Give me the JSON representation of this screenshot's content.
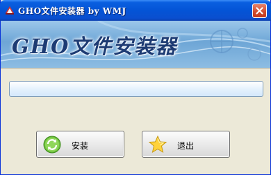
{
  "window": {
    "title": "GHO文件安装器  by WMJ"
  },
  "banner": {
    "title": "GHO文件安装器"
  },
  "progress": {
    "value_percent": 0
  },
  "buttons": {
    "install_label": "安装",
    "exit_label": "退出"
  },
  "icons": {
    "app": "app-logo-icon",
    "close": "close-icon",
    "install": "refresh-icon",
    "exit": "star-icon"
  },
  "colors": {
    "titlebar": "#0454d6",
    "close_button": "#d14a2c",
    "window_bg": "#ece9d8",
    "progress_bg": "#e6f2fd"
  }
}
